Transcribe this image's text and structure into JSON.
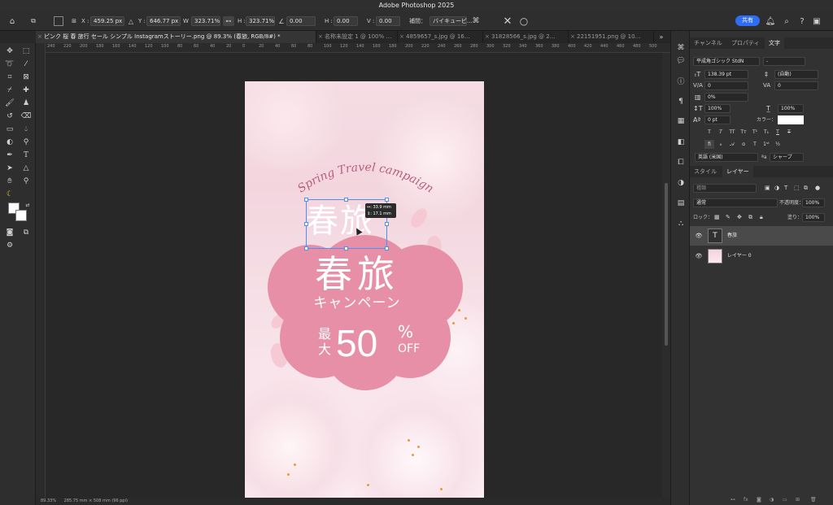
{
  "app": {
    "title": "Adobe Photoshop 2025"
  },
  "options_bar": {
    "x": "459.25 px",
    "y": "646.77 px",
    "w": "323.71%",
    "h": "323.71%",
    "angle": "0.00",
    "h_skew": "0.00",
    "v_skew": "0.00",
    "interp_label": "補間：",
    "interp": "バイキュービ…",
    "x_label": "X :",
    "y_label": "Y :",
    "w_label": "W :",
    "h_label": "H :",
    "hskew_label": "H :",
    "vskew_label": "V :",
    "share": "共有"
  },
  "tabs": [
    "ピンク 桜 春 旅行 セール シンプル Instagramストーリー.png @ 89.3% (春旅, RGB/8#) *",
    "名称未設定 1 @ 100% …",
    "4859657_s.jpg @ 16…",
    "31828566_s.jpg @ 2…",
    "22151951.png @ 10…"
  ],
  "rulers": [
    "240",
    "220",
    "200",
    "180",
    "160",
    "140",
    "120",
    "100",
    "80",
    "60",
    "40",
    "20",
    "0",
    "20",
    "40",
    "60",
    "80",
    "100",
    "120",
    "140",
    "160",
    "180",
    "200",
    "220",
    "240",
    "260",
    "280",
    "300",
    "320",
    "340",
    "360",
    "380",
    "400",
    "420",
    "440",
    "460",
    "480",
    "500",
    "520"
  ],
  "document": {
    "arc_text": "Spring Travel campaign",
    "selected_text": "春旅",
    "title": "春旅",
    "subtitle": "キャンペーン",
    "discount_prefix": "最大",
    "discount_value": "50",
    "discount_percent": "%",
    "discount_off": "OFF",
    "measure_w": "↔: 33.9 mm",
    "measure_h": "↕:  17.1 mm"
  },
  "status": {
    "zoom": "89.33%",
    "size": "285.75 mm × 508 mm (96 ppi)"
  },
  "character_panel": {
    "tabs": [
      "チャンネル",
      "プロパティ",
      "文字"
    ],
    "font_family": "平成角ゴシック StdN",
    "font_style": "-",
    "size": "138.39 pt",
    "leading": "(自動)",
    "kerning": "0",
    "tracking": "0",
    "tsume": "0%",
    "v_scale": "100%",
    "h_scale": "100%",
    "baseline": "0 pt",
    "color_label": "カラー：",
    "language": "英語 (米国)",
    "aa_label": "ªa",
    "antialias": "シャープ"
  },
  "layers_panel": {
    "tabs": [
      "スタイル",
      "レイヤー"
    ],
    "search_placeholder": "種類",
    "blend_mode": "通常",
    "opacity_label": "不透明度：",
    "opacity": "100%",
    "lock_label": "ロック：",
    "fill_label": "塗り：",
    "fill": "100%",
    "layers": [
      {
        "name": "春旅",
        "type": "T"
      },
      {
        "name": "レイヤー 0",
        "type": "img"
      }
    ]
  },
  "colors": {
    "accent": "#2f6df6",
    "sakura": "#e68fa6",
    "selection": "#4e8ff7"
  }
}
